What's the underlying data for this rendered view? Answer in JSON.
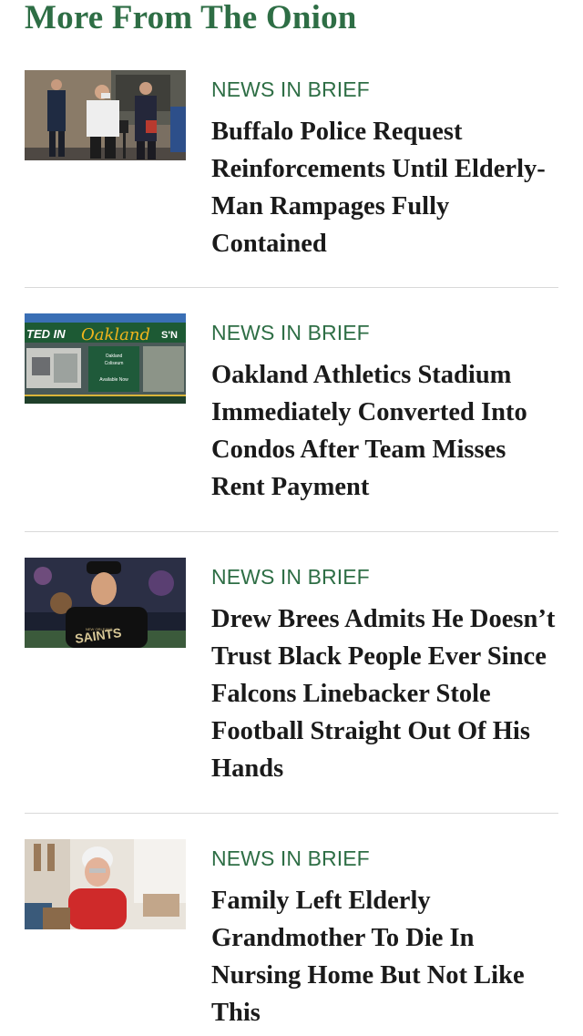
{
  "section": {
    "title": "More From The Onion"
  },
  "articles": [
    {
      "kicker": "NEWS IN BRIEF",
      "headline": "Buffalo Police Request Reinforcements Until Elderly-Man Rampages Fully Contained",
      "thumbnail_icon": "press-conference-photo"
    },
    {
      "kicker": "NEWS IN BRIEF",
      "headline": "Oakland Athletics Stadium Immediately Converted Into Condos After Team Misses Rent Payment",
      "thumbnail_icon": "stadium-photo",
      "thumbnail_text": {
        "left": "TED IN",
        "script": "Oakland",
        "right": "S'N",
        "sign_line1": "Oakland",
        "sign_line2": "Coliseum",
        "sign_line3": "Available Now"
      }
    },
    {
      "kicker": "NEWS IN BRIEF",
      "headline": "Drew Brees Admits He Doesn’t Trust Black People Ever Since Falcons Linebacker Stole Football Straight Out Of His Hands",
      "thumbnail_icon": "football-player-photo",
      "thumbnail_text": {
        "shirt_small": "NEW ORLEANS",
        "shirt": "SAINTS"
      }
    },
    {
      "kicker": "NEWS IN BRIEF",
      "headline": "Family Left Elderly Grandmother To Die In Nursing Home But Not Like This",
      "thumbnail_icon": "elderly-woman-photo"
    }
  ]
}
